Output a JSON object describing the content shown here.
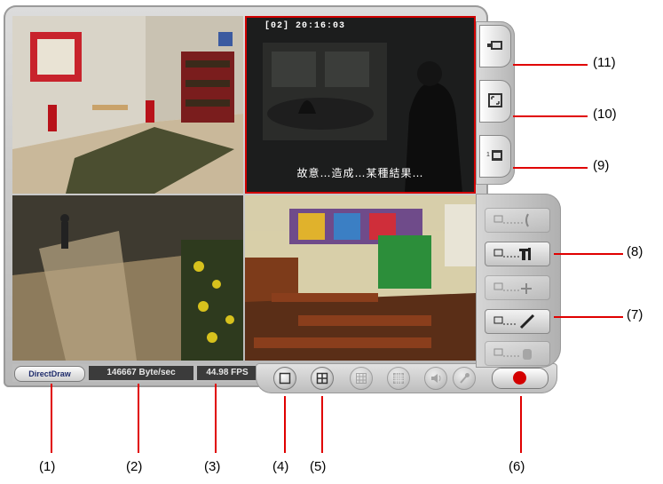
{
  "video": {
    "cam2_label": "[02]  20:16:03",
    "cam2_subtitle": "故意…造成…某種結果…"
  },
  "status_bar": {
    "render_mode": "DirectDraw",
    "data_rate": "146667 Byte/sec",
    "frame_rate": "44.98 FPS"
  },
  "controls": [
    {
      "id": "single-view",
      "icon": "square-icon"
    },
    {
      "id": "quad-view",
      "icon": "quad-grid-icon"
    },
    {
      "id": "nine-view",
      "icon": "nine-grid-icon",
      "enabled": false
    },
    {
      "id": "sixteen-view",
      "icon": "sixteen-grid-icon",
      "enabled": false
    },
    {
      "id": "audio",
      "icon": "speaker-icon",
      "enabled": false
    },
    {
      "id": "microphone",
      "icon": "microphone-icon",
      "enabled": false
    },
    {
      "id": "record",
      "icon": "record-dot-icon",
      "color": "#d40000"
    }
  ],
  "side_tabs": [
    {
      "icon": "camera-icon"
    },
    {
      "icon": "fullscreen-icon"
    },
    {
      "icon": "snapshot-icon"
    }
  ],
  "side_buttons": [
    {
      "icon": "network-phone-icon",
      "enabled": false
    },
    {
      "icon": "network-tools-icon",
      "enabled": true
    },
    {
      "icon": "network-plus-icon",
      "enabled": false
    },
    {
      "icon": "network-pen-icon",
      "enabled": true
    },
    {
      "icon": "network-hand-icon",
      "enabled": false
    }
  ],
  "callouts": {
    "c1": "(1)",
    "c2": "(2)",
    "c3": "(3)",
    "c4": "(4)",
    "c5": "(5)",
    "c6": "(6)",
    "c7": "(7)",
    "c8": "(8)",
    "c9": "(9)",
    "c10": "(10)",
    "c11": "(11)"
  },
  "colors": {
    "accent_red": "#e00000",
    "record_red": "#d40000",
    "panel_gray": "#c8c8c8"
  }
}
